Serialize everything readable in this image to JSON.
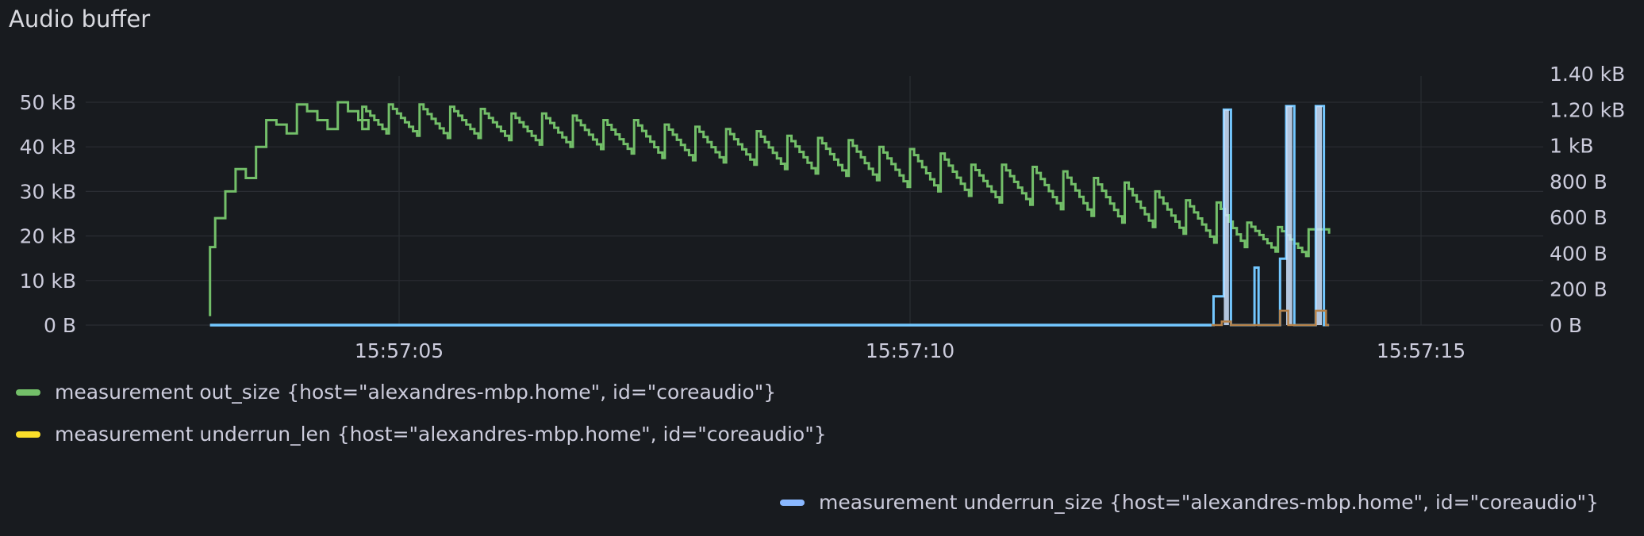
{
  "panel": {
    "title": "Audio buffer"
  },
  "chart_data": {
    "type": "line",
    "title": "Audio buffer",
    "grid": true,
    "legend_position": "bottom",
    "x_axis": {
      "unit": "seconds",
      "range": [
        0.0,
        14.1
      ],
      "tick_labels": [
        "15:57:05",
        "15:57:10",
        "15:57:15"
      ],
      "tick_values": [
        5,
        10,
        15
      ]
    },
    "y_axis_left": {
      "range": [
        0,
        50
      ],
      "unit": "kB",
      "tick_labels": [
        "0 B",
        "10 kB",
        "20 kB",
        "30 kB",
        "40 kB",
        "50 kB"
      ],
      "tick_values": [
        0,
        10,
        20,
        30,
        40,
        50
      ]
    },
    "y_axis_right": {
      "range": [
        0,
        1.4
      ],
      "unit": "kB",
      "tick_labels": [
        "0 B",
        "200 B",
        "400 B",
        "600 B",
        "800 B",
        "1 kB",
        "1.20 kB",
        "1.40 kB"
      ],
      "tick_values": [
        0,
        0.2,
        0.4,
        0.6,
        0.8,
        1.0,
        1.2,
        1.4
      ]
    },
    "series": [
      {
        "name": "measurement out_size {host=\"alexandres-mbp.home\", id=\"coreaudio\"}",
        "color": "#73bf69",
        "axis": "left",
        "x": [
          3.15,
          3.15,
          3.2,
          3.3,
          3.4,
          3.5,
          3.6,
          3.7,
          3.8,
          3.9,
          4.0,
          4.1,
          4.2,
          4.3,
          4.4,
          4.5,
          4.6,
          4.7
        ],
        "y": [
          2.0,
          17.5,
          24.0,
          30.0,
          35.0,
          33.0,
          40.0,
          46.0,
          45.0,
          43.0,
          49.5,
          48.0,
          46.0,
          44.0,
          50.0,
          48.0,
          46.0,
          44.0
        ],
        "peaks_x": [
          4.6,
          4.9,
          5.2,
          5.5,
          5.8,
          6.1,
          6.4,
          6.7,
          7.0,
          7.3,
          7.6,
          7.9,
          8.2,
          8.5,
          8.8,
          9.1,
          9.4,
          9.7,
          10.0,
          10.3,
          10.6,
          10.9,
          11.2,
          11.5,
          11.8,
          12.1,
          12.4,
          12.7,
          13.0,
          13.3,
          13.6,
          13.9
        ],
        "peaks_y": [
          50.0,
          49.5,
          49.5,
          49.0,
          48.5,
          47.5,
          47.5,
          47.0,
          46.0,
          46.0,
          45.0,
          44.5,
          44.0,
          43.5,
          42.5,
          42.0,
          41.5,
          40.0,
          39.5,
          38.5,
          36.0,
          36.0,
          35.5,
          34.5,
          33.0,
          32.0,
          30.0,
          28.0,
          27.5,
          23.0,
          22.0,
          21.5
        ],
        "troughs_y": [
          43.0,
          42.5,
          42.0,
          42.0,
          41.5,
          40.5,
          40.0,
          39.5,
          38.5,
          37.5,
          37.0,
          36.5,
          36.0,
          35.0,
          34.0,
          33.5,
          32.5,
          31.0,
          30.0,
          29.0,
          27.5,
          27.0,
          26.0,
          24.5,
          23.0,
          22.0,
          20.5,
          18.5,
          17.5,
          16.5,
          15.5,
          15.0
        ]
      },
      {
        "name": "measurement underrun_len {host=\"alexandres-mbp.home\", id=\"coreaudio\"}",
        "color": "#fade2a",
        "axis": "right",
        "x": [
          3.15,
          13.03,
          13.05,
          13.12,
          13.14,
          13.6,
          13.62,
          13.68,
          13.7,
          13.95,
          13.97,
          14.05,
          14.07,
          14.1
        ],
        "y": [
          0.0,
          0.0,
          0.02,
          0.02,
          0.0,
          0.0,
          0.08,
          0.08,
          0.0,
          0.0,
          0.08,
          0.08,
          0.0,
          0.0
        ]
      },
      {
        "name": "measurement underrun_size {host=\"alexandres-mbp.home\", id=\"coreaudio\"}",
        "color": "#8ab8ff",
        "axis": "right",
        "x": [
          3.15,
          12.95,
          12.97,
          13.05,
          13.07,
          13.12,
          13.14,
          13.35,
          13.37,
          13.39,
          13.41,
          13.6,
          13.62,
          13.66,
          13.68,
          13.74,
          13.76,
          13.95,
          13.97,
          14.03,
          14.05,
          14.1
        ],
        "y": [
          0.0,
          0.0,
          0.16,
          0.16,
          1.2,
          1.2,
          0.0,
          0.0,
          0.32,
          0.32,
          0.0,
          0.0,
          0.37,
          0.37,
          1.22,
          1.22,
          0.0,
          0.0,
          1.22,
          1.22,
          0.0,
          0.0
        ]
      }
    ]
  },
  "legend": {
    "items": [
      {
        "label": "measurement out_size {host=\"alexandres-mbp.home\", id=\"coreaudio\"}",
        "color": "#73bf69"
      },
      {
        "label": "measurement underrun_len {host=\"alexandres-mbp.home\", id=\"coreaudio\"}",
        "color": "#fade2a"
      },
      {
        "label": "measurement underrun_size {host=\"alexandres-mbp.home\", id=\"coreaudio\"}",
        "color": "#8ab8ff"
      }
    ]
  }
}
